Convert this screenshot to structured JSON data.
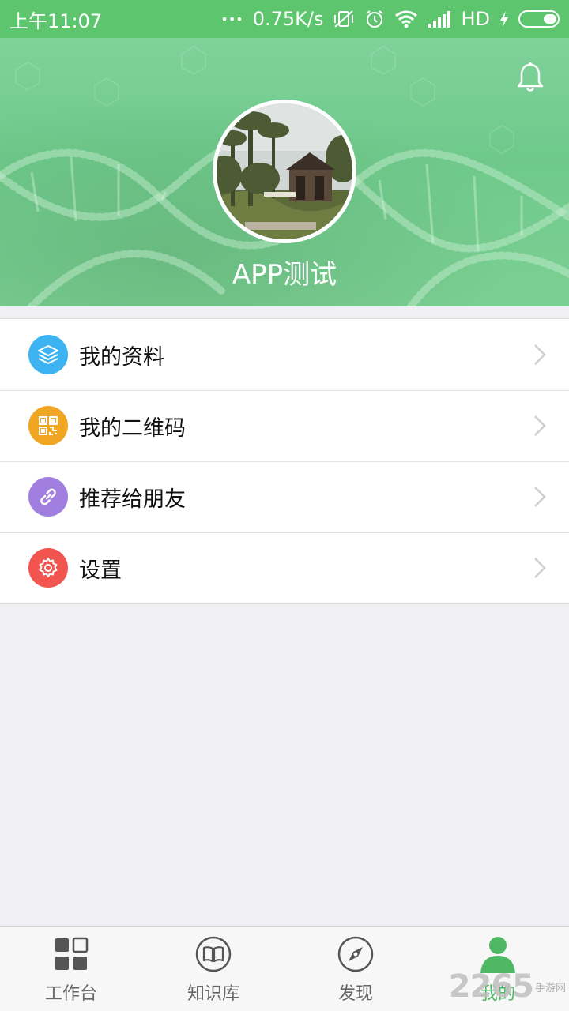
{
  "status_bar": {
    "time": "上午11:07",
    "dots": "•••",
    "speed": "0.75K/s",
    "network": "HD"
  },
  "profile": {
    "name": "APP测试"
  },
  "menu": [
    {
      "label": "我的资料",
      "icon": "layers-icon",
      "color": "#3db3f2"
    },
    {
      "label": "我的二维码",
      "icon": "qrcode-icon",
      "color": "#f0a623"
    },
    {
      "label": "推荐给朋友",
      "icon": "link-icon",
      "color": "#a07fe0"
    },
    {
      "label": "设置",
      "icon": "gear-icon",
      "color": "#f25450"
    }
  ],
  "tabs": [
    {
      "label": "工作台",
      "icon": "grid-icon"
    },
    {
      "label": "知识库",
      "icon": "book-icon"
    },
    {
      "label": "发现",
      "icon": "compass-icon"
    },
    {
      "label": "我的",
      "icon": "person-icon",
      "active": true
    }
  ],
  "colors": {
    "brand": "#5cc56e",
    "active_tab": "#4fb865"
  },
  "watermark": {
    "number": "2265",
    "text": "手游网"
  }
}
